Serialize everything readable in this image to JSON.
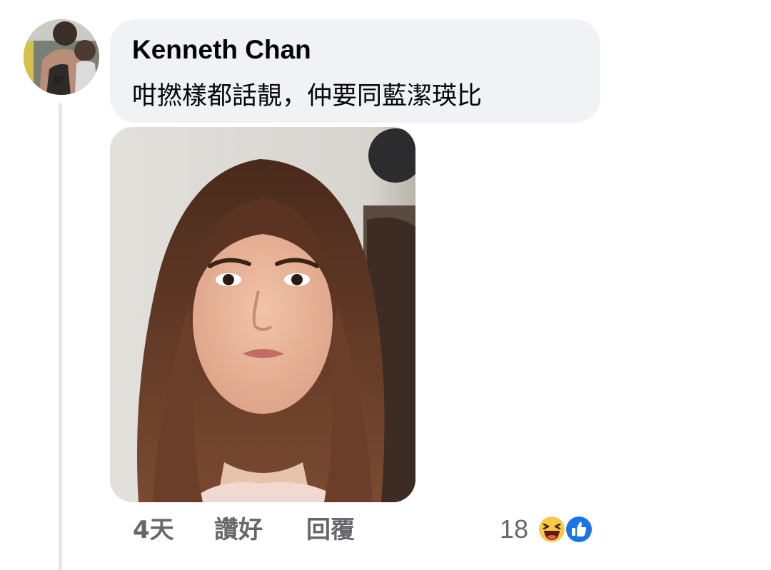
{
  "comment": {
    "author": "Kenneth Chan",
    "text": "咁撚樣都話靚，仲要同藍潔瑛比"
  },
  "actions": {
    "time": "4天",
    "like_label": "讚好",
    "reply_label": "回覆"
  },
  "reactions": {
    "count": "18",
    "icons": [
      "haha-icon",
      "like-icon"
    ]
  },
  "colors": {
    "bubble_bg": "#f0f2f5",
    "secondary_text": "#65676b",
    "like_blue": "#1b74e4",
    "haha_yellow": "#f7c84a"
  }
}
